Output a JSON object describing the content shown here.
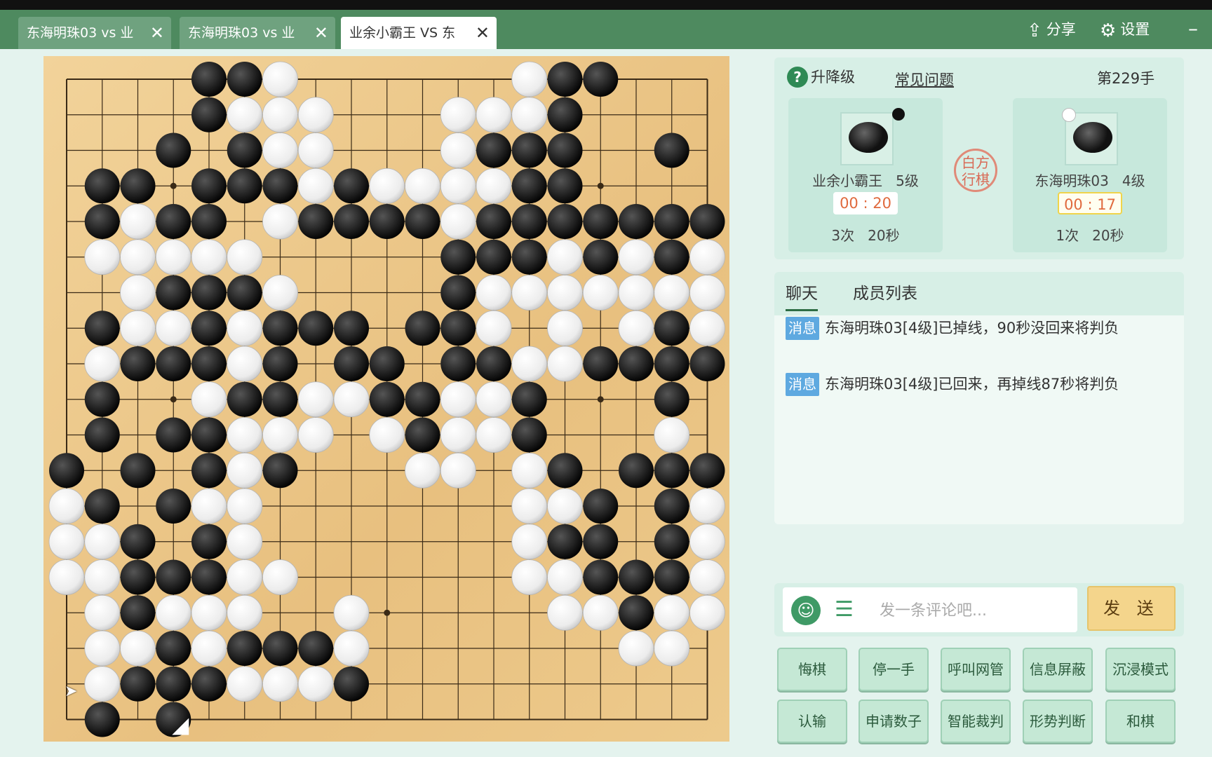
{
  "tabs": [
    {
      "label": "东海明珠03 vs 业",
      "close": "✕"
    },
    {
      "label": "东海明珠03 vs 业",
      "close": "✕"
    },
    {
      "label": "业余小霸王 VS 东",
      "close": "✕"
    }
  ],
  "top_actions": {
    "share": "分享",
    "share_icon": "⇪",
    "settings": "设置",
    "settings_icon": "⚙",
    "minimize": "–"
  },
  "info": {
    "help_icon": "?",
    "rank_link": "升降级",
    "faq_link": "常见问题",
    "move_count": "第229手",
    "stamp": "白方行棋"
  },
  "players": [
    {
      "name": "业余小霸王",
      "rank": "5级",
      "color": "black",
      "timer": "00 : 20",
      "byoyomi_count": "3次",
      "byoyomi_time": "20秒"
    },
    {
      "name": "东海明珠03",
      "rank": "4级",
      "color": "white",
      "timer": "00 : 17",
      "byoyomi_count": "1次",
      "byoyomi_time": "20秒"
    }
  ],
  "chat": {
    "tabs": [
      "聊天",
      "成员列表"
    ],
    "messages": [
      {
        "tag": "消息",
        "text": "东海明珠03[4级]已掉线，90秒没回来将判负"
      },
      {
        "tag": "消息",
        "text": "东海明珠03[4级]已回来，再掉线87秒将判负"
      }
    ]
  },
  "comment": {
    "placeholder": "发一条评论吧...",
    "send": "发 送",
    "emoji_icon": "☺",
    "list_icon": "☰"
  },
  "actions_row1": [
    "悔棋",
    "停一手",
    "呼叫网管",
    "信息屏蔽",
    "沉浸模式"
  ],
  "actions_row2": [
    "认输",
    "申请数子",
    "智能裁判",
    "形势判断",
    "和棋"
  ],
  "board": {
    "size": 19,
    "star_points": [
      [
        3,
        3
      ],
      [
        3,
        9
      ],
      [
        3,
        15
      ],
      [
        9,
        3
      ],
      [
        9,
        9
      ],
      [
        9,
        15
      ],
      [
        15,
        3
      ],
      [
        15,
        9
      ],
      [
        15,
        15
      ]
    ],
    "last_move": [
      3,
      18
    ],
    "grid": [
      "....BBW......WBB...",
      "....BWWW...WWWB....",
      "...B.BWW...WBBB..B.",
      ".BB.BBBWBWWWWBB....",
      ".BWBB.WBBBBWBBBBBBB",
      ".WWWWW.....BBBWBWBW",
      "..WBBBW....BWWWWWWW",
      ".BWWBWBBB.BBW.W.WBW",
      ".WBBBWB.BB.BBWWBBBB",
      ".B..WBBWWBBWWB...B.",
      ".B.BBWWW.WBWWB...W.",
      "B.B.BWB...WW.WB.BBB",
      "WB.BWW.......WWB.BW",
      "WWB.BW.......WBB.BW",
      "WWBBBWW......WWBBBW",
      ".WBWWW..W.....WWBWW",
      ".WWBWBBBW.......WW.",
      ".WBBBWWWB..........",
      ".B.B..............."
    ]
  }
}
